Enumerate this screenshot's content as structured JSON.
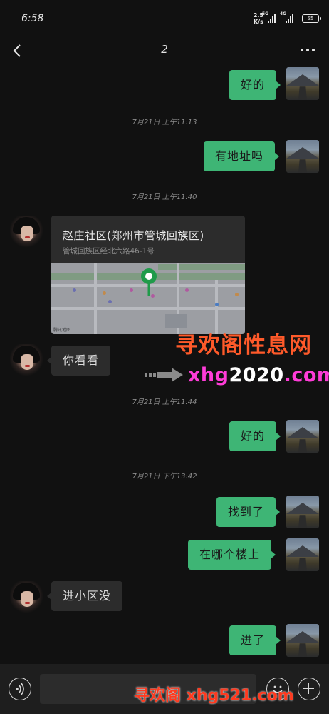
{
  "status_bar": {
    "time": "6:58",
    "speed_value": "2.5",
    "speed_unit": "K/s",
    "net1": "5G",
    "net2": "4G",
    "battery": "55"
  },
  "header": {
    "title": "2"
  },
  "messages": [
    {
      "type": "text",
      "side": "me",
      "text": "好的"
    },
    {
      "type": "timestamp",
      "text": "7月21日 上午11:13"
    },
    {
      "type": "text",
      "side": "me",
      "text": "有地址吗"
    },
    {
      "type": "timestamp",
      "text": "7月21日 上午11:40"
    },
    {
      "type": "location",
      "side": "other",
      "title": "赵庄社区(郑州市管城回族区)",
      "address": "管城回族区经北六路46-1号",
      "map_credit": "腾讯地图"
    },
    {
      "type": "text",
      "side": "other",
      "text": "你看看"
    },
    {
      "type": "timestamp",
      "text": "7月21日 上午11:44"
    },
    {
      "type": "text",
      "side": "me",
      "text": "好的"
    },
    {
      "type": "timestamp",
      "text": "7月21日 下午13:42"
    },
    {
      "type": "text",
      "side": "me",
      "text": "找到了"
    },
    {
      "type": "text",
      "side": "me",
      "text": "在哪个楼上"
    },
    {
      "type": "text",
      "side": "other",
      "text": "进小区没"
    },
    {
      "type": "text",
      "side": "me",
      "text": "进了"
    }
  ],
  "watermarks": {
    "line1": "寻欢阁性息网",
    "line2_prefix": "xhg",
    "line2_hl": "2020",
    "line2_suffix": ".com",
    "bottom": "寻欢阁 xhg521.com"
  },
  "input": {
    "value": ""
  },
  "colors": {
    "background": "#111111",
    "bubble_me": "#3eb575",
    "bubble_other": "#2c2c2c"
  }
}
